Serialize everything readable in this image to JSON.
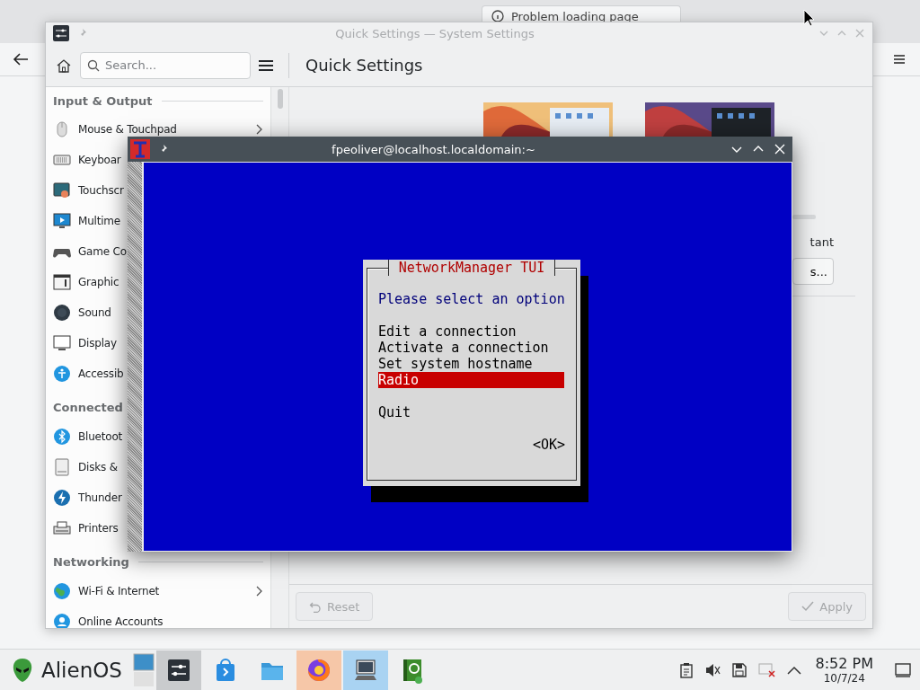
{
  "browser": {
    "tab_title": "Problem loading page"
  },
  "settings": {
    "title": "Quick Settings — System Settings",
    "search_placeholder": "Search...",
    "page_title": "Quick Settings",
    "sidebar": [
      {
        "heading": "Input & Output",
        "items": [
          {
            "label": "Mouse & Touchpad",
            "submenu": true
          },
          {
            "label": "Keyboar",
            "submenu": false
          },
          {
            "label": "Touchscr",
            "submenu": false
          },
          {
            "label": "Multime",
            "submenu": false
          },
          {
            "label": "Game Co",
            "submenu": false
          },
          {
            "label": "Graphic",
            "submenu": false
          },
          {
            "label": "Sound",
            "submenu": false
          },
          {
            "label": "Display",
            "submenu": false
          },
          {
            "label": "Accessib",
            "submenu": false
          }
        ]
      },
      {
        "heading": "Connected",
        "items": [
          {
            "label": "Bluetoot",
            "submenu": false
          },
          {
            "label": "Disks &",
            "submenu": false
          },
          {
            "label": "Thunder",
            "submenu": false
          },
          {
            "label": "Printers",
            "submenu": false
          }
        ]
      },
      {
        "heading": "Networking",
        "items": [
          {
            "label": "Wi-Fi & Internet",
            "submenu": true
          },
          {
            "label": "Online Accounts",
            "submenu": false
          }
        ]
      }
    ],
    "content": {
      "label_fragment": "tant",
      "button_fragment": "s..."
    },
    "footer": [
      {
        "label": "Reset",
        "disabled": true
      },
      {
        "label": "Apply",
        "disabled": true
      }
    ]
  },
  "terminal": {
    "title": "fpeoliver@localhost.localdomain:~",
    "dialog": {
      "title": "NetworkManager TUI",
      "prompt": "Please select an option",
      "option_groups": [
        [
          {
            "label": "Edit a connection",
            "selected": false
          },
          {
            "label": "Activate a connection",
            "selected": false
          },
          {
            "label": "Set system hostname",
            "selected": false
          },
          {
            "label": "Radio",
            "selected": true
          }
        ],
        [
          {
            "label": "Quit",
            "selected": false
          }
        ]
      ],
      "ok_button": "<OK>"
    }
  },
  "taskbar": {
    "launcher": "AlienOS",
    "tasks": [
      {
        "open": true,
        "active": false,
        "attention": false
      },
      {
        "open": false,
        "active": false,
        "attention": false
      },
      {
        "open": false,
        "active": false,
        "attention": false
      },
      {
        "open": false,
        "active": false,
        "attention": true
      },
      {
        "open": false,
        "active": true,
        "attention": false
      },
      {
        "open": false,
        "active": false,
        "attention": false
      }
    ],
    "clock": {
      "time": "8:52 PM",
      "date": "10/7/24"
    }
  }
}
